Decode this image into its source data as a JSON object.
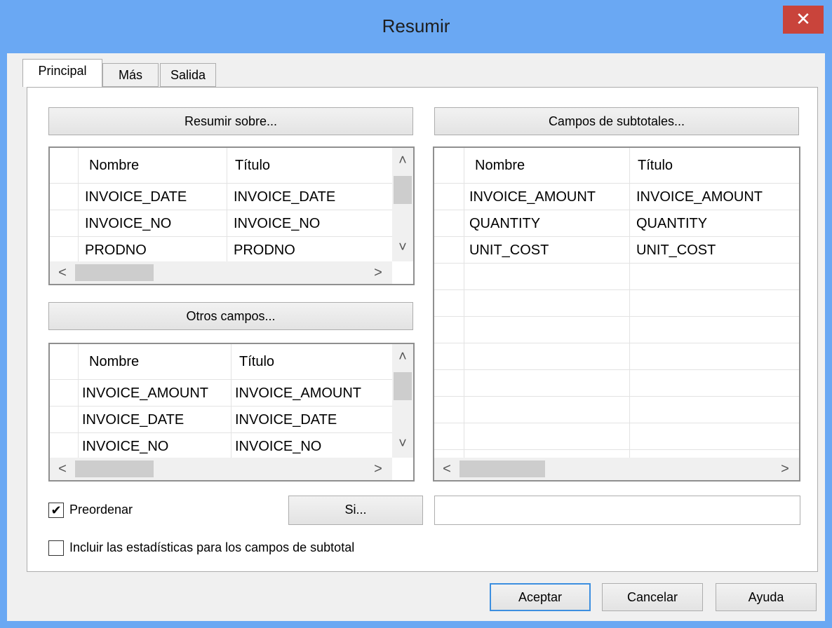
{
  "window": {
    "title": "Resumir",
    "close_symbol": "✕"
  },
  "tabs": [
    "Principal",
    "Más",
    "Salida"
  ],
  "summarize_on": {
    "button_label": "Resumir sobre...",
    "columns": [
      "Nombre",
      "Título"
    ],
    "rows": [
      [
        "INVOICE_DATE",
        "INVOICE_DATE"
      ],
      [
        "INVOICE_NO",
        "INVOICE_NO"
      ],
      [
        "PRODNO",
        "PRODNO"
      ]
    ]
  },
  "other_fields": {
    "button_label": "Otros campos...",
    "columns": [
      "Nombre",
      "Título"
    ],
    "rows": [
      [
        "INVOICE_AMOUNT",
        "INVOICE_AMOUNT"
      ],
      [
        "INVOICE_DATE",
        "INVOICE_DATE"
      ],
      [
        "INVOICE_NO",
        "INVOICE_NO"
      ]
    ]
  },
  "subtotal_fields": {
    "button_label": "Campos de subtotales...",
    "columns": [
      "Nombre",
      "Título"
    ],
    "rows": [
      [
        "INVOICE_AMOUNT",
        "INVOICE_AMOUNT"
      ],
      [
        "QUANTITY",
        "QUANTITY"
      ],
      [
        "UNIT_COST",
        "UNIT_COST"
      ]
    ]
  },
  "presort": {
    "label": "Preordenar",
    "checked": true,
    "check_symbol": "✔"
  },
  "if_button": {
    "label": "Si..."
  },
  "if_field": {
    "value": ""
  },
  "include_stats": {
    "label": "Incluir las estadísticas para los campos de subtotal",
    "checked": false
  },
  "footer": {
    "ok": "Aceptar",
    "cancel": "Cancelar",
    "help": "Ayuda"
  },
  "scroll_arrows": {
    "up": "˄",
    "down": "˅",
    "left": "<",
    "right": ">"
  }
}
